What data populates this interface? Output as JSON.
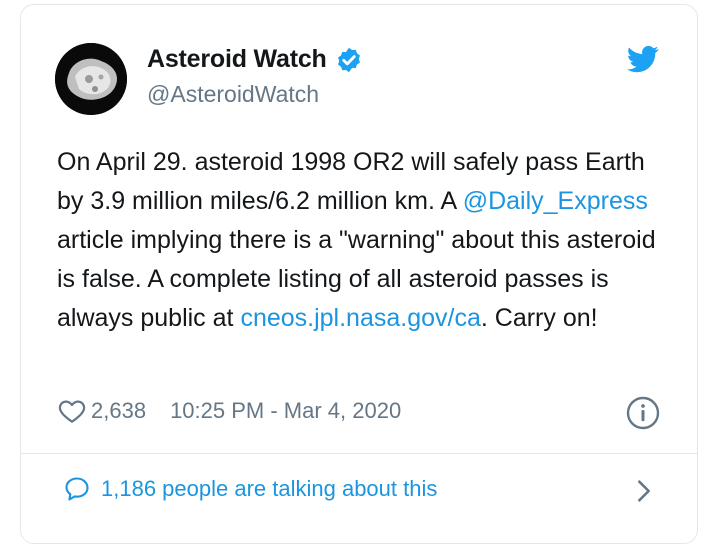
{
  "author": {
    "display_name": "Asteroid Watch",
    "handle": "@AsteroidWatch",
    "verified": true
  },
  "tweet": {
    "text_part1": "On April 29. asteroid 1998 OR2 will safely pass Earth by 3.9 million miles/6.2 million km. A ",
    "mention": "@Daily_Express",
    "text_part2": " article implying there is a \"warning\" about this asteroid is false. A complete listing of all asteroid passes is always public at ",
    "link": "cneos.jpl.nasa.gov/ca",
    "text_part3": ". Carry on!"
  },
  "meta": {
    "like_count": "2,638",
    "timestamp": "10:25 PM - Mar 4, 2020"
  },
  "footer": {
    "talking_text": "1,186 people are talking about this"
  },
  "colors": {
    "link": "#1b95e0",
    "muted": "#657786",
    "border": "#e1e8ed"
  },
  "icons": [
    "avatar-asteroid",
    "verified-badge-icon",
    "twitter-logo-icon",
    "heart-icon",
    "info-icon",
    "speech-bubble-icon",
    "chevron-right-icon"
  ]
}
